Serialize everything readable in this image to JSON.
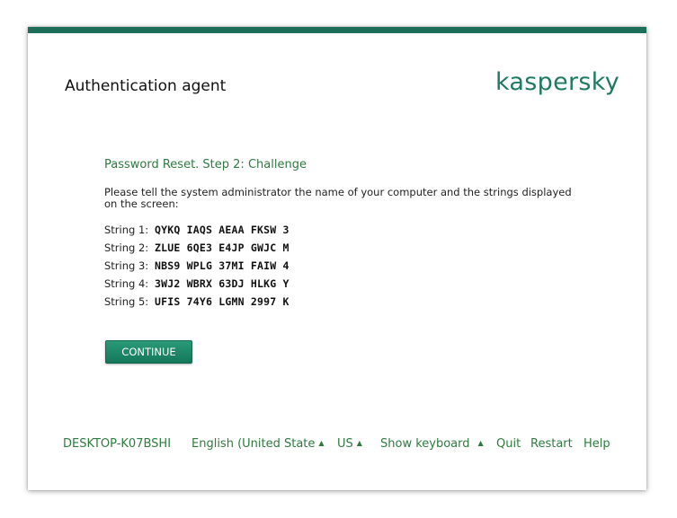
{
  "header": {
    "title": "Authentication agent",
    "logo_text": "kaspersky"
  },
  "main": {
    "step_title": "Password Reset. Step 2: Challenge",
    "instructions": "Please tell the system administrator the name of your computer and the strings displayed on the screen:",
    "strings": [
      {
        "label": "String 1:",
        "value": "QYKQ IAQS AEAA FKSW 3"
      },
      {
        "label": "String 2:",
        "value": "ZLUE 6QE3 E4JP GWJC M"
      },
      {
        "label": "String 3:",
        "value": "NBS9 WPLG 37MI FAIW 4"
      },
      {
        "label": "String 4:",
        "value": "3WJ2 WBRX 63DJ HLKG Y"
      },
      {
        "label": "String 5:",
        "value": "UFIS 74Y6 LGMN 2997 K"
      }
    ],
    "continue_label": "CONTINUE"
  },
  "footer": {
    "computer_name": "DESKTOP-K07BSHI",
    "language": "English (United State",
    "keyboard_layout": "US",
    "show_keyboard": "Show keyboard",
    "quit": "Quit",
    "restart": "Restart",
    "help": "Help",
    "caret_glyph": "▲"
  },
  "colors": {
    "accent": "#1f6e5c",
    "link_green": "#2f7a3f",
    "button": "#14785a"
  }
}
